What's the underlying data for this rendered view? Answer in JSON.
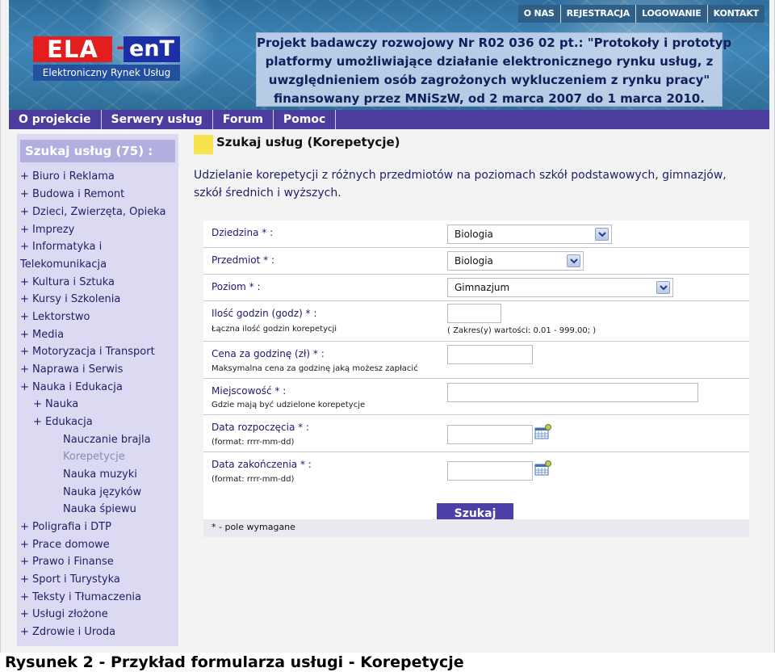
{
  "top_nav": {
    "items": [
      "O NAS",
      "REJESTRACJA",
      "LOGOWANIE",
      "KONTAKT"
    ]
  },
  "logo": {
    "brand_left": "ELA",
    "dash": "-",
    "brand_right": "enT",
    "subtitle": "Elektroniczny Rynek Usług"
  },
  "project_info": {
    "lines": [
      "Projekt badawczy rozwojowy Nr R02 036 02 pt.: \"Protokoły i prototyp",
      "platformy umożliwiające działanie elektronicznego rynku usług, z",
      "uwzględnieniem osób zagrożonych wykluczeniem z rynku pracy\"",
      "finansowany przez MNiSzW, od 2 marca 2007 do 1 marca 2010."
    ]
  },
  "main_nav": {
    "items": [
      "O projekcie",
      "Serwery usług",
      "Forum",
      "Pomoc"
    ]
  },
  "sidebar": {
    "title": "Szukaj usług (75) :",
    "items": [
      {
        "label": "+ Biuro i Reklama"
      },
      {
        "label": "+ Budowa i Remont"
      },
      {
        "label": "+ Dzieci, Zwierzęta, Opieka"
      },
      {
        "label": "+ Imprezy"
      },
      {
        "label": "+ Informatyka i"
      },
      {
        "label": "Telekomunikacja"
      },
      {
        "label": "+ Kultura i Sztuka"
      },
      {
        "label": "+ Kursy i Szkolenia"
      },
      {
        "label": "+ Lektorstwo"
      },
      {
        "label": "+ Media"
      },
      {
        "label": "+ Motoryzacja i Transport"
      },
      {
        "label": "+ Naprawa i Serwis"
      },
      {
        "label": "+ Nauka i Edukacja"
      },
      {
        "label": "+ Nauka"
      },
      {
        "label": "+ Edukacja"
      },
      {
        "label": "Nauczanie brajla"
      },
      {
        "label": "Korepetycje"
      },
      {
        "label": "Nauka muzyki"
      },
      {
        "label": "Nauka języków"
      },
      {
        "label": "Nauka śpiewu"
      },
      {
        "label": "+ Poligrafia i DTP"
      },
      {
        "label": "+ Prace domowe"
      },
      {
        "label": "+ Prawo i Finanse"
      },
      {
        "label": "+ Sport i Turystyka"
      },
      {
        "label": "+ Teksty i Tłumaczenia"
      },
      {
        "label": "+ Usługi złożone"
      },
      {
        "label": "+ Zdrowie i Uroda"
      }
    ]
  },
  "main": {
    "title": "Szukaj usług (Korepetycje)",
    "description": "Udzielanie korepetycji z różnych przedmiotów na poziomach szkół podstawowych, gimnazjów, szkół średnich i wyższych."
  },
  "form": {
    "dziedzina_label": "Dziedzina * :",
    "dziedzina_value": "Biologia",
    "przedmiot_label": "Przedmiot * :",
    "przedmiot_value": "Biologia",
    "poziom_label": "Poziom * :",
    "poziom_value": "Gimnazjum",
    "godzin_label": "Ilość godzin (godz) * :",
    "godzin_hint": "Łączna ilość godzin korepetycji",
    "godzin_range": "( Zakres(y) wartości: 0.01 - 999.00; )",
    "cena_label": "Cena za godzinę (zł) * :",
    "cena_hint": "Maksymalna cena za godzinę jaką możesz zapłacić",
    "miejscowosc_label": "Miejscowość * :",
    "miejscowosc_hint": "Gdzie mają być udzielone korepetycje",
    "start_label": "Data rozpoczęcia * :",
    "start_hint": "(format: rrrr-mm-dd)",
    "end_label": "Data zakończenia * :",
    "end_hint": "(format: rrrr-mm-dd)",
    "submit_label": "Szukaj",
    "required_note": "* - pole wymagane"
  },
  "caption": "Rysunek 2 - Przykład formularza usługi - Korepetycje",
  "colors": {
    "nav_bar": "#4a3d9e",
    "sidebar_bg": "#dcdaf2",
    "sidebar_title": "#b3aee0",
    "title_marker": "#f6e24d",
    "submit_button": "#4b3fa8",
    "logo_red": "#e41e1e",
    "logo_blue": "#1d2fa6"
  },
  "icons": {
    "dropdown": "chevron-down-icon",
    "calendar": "calendar-icon"
  }
}
